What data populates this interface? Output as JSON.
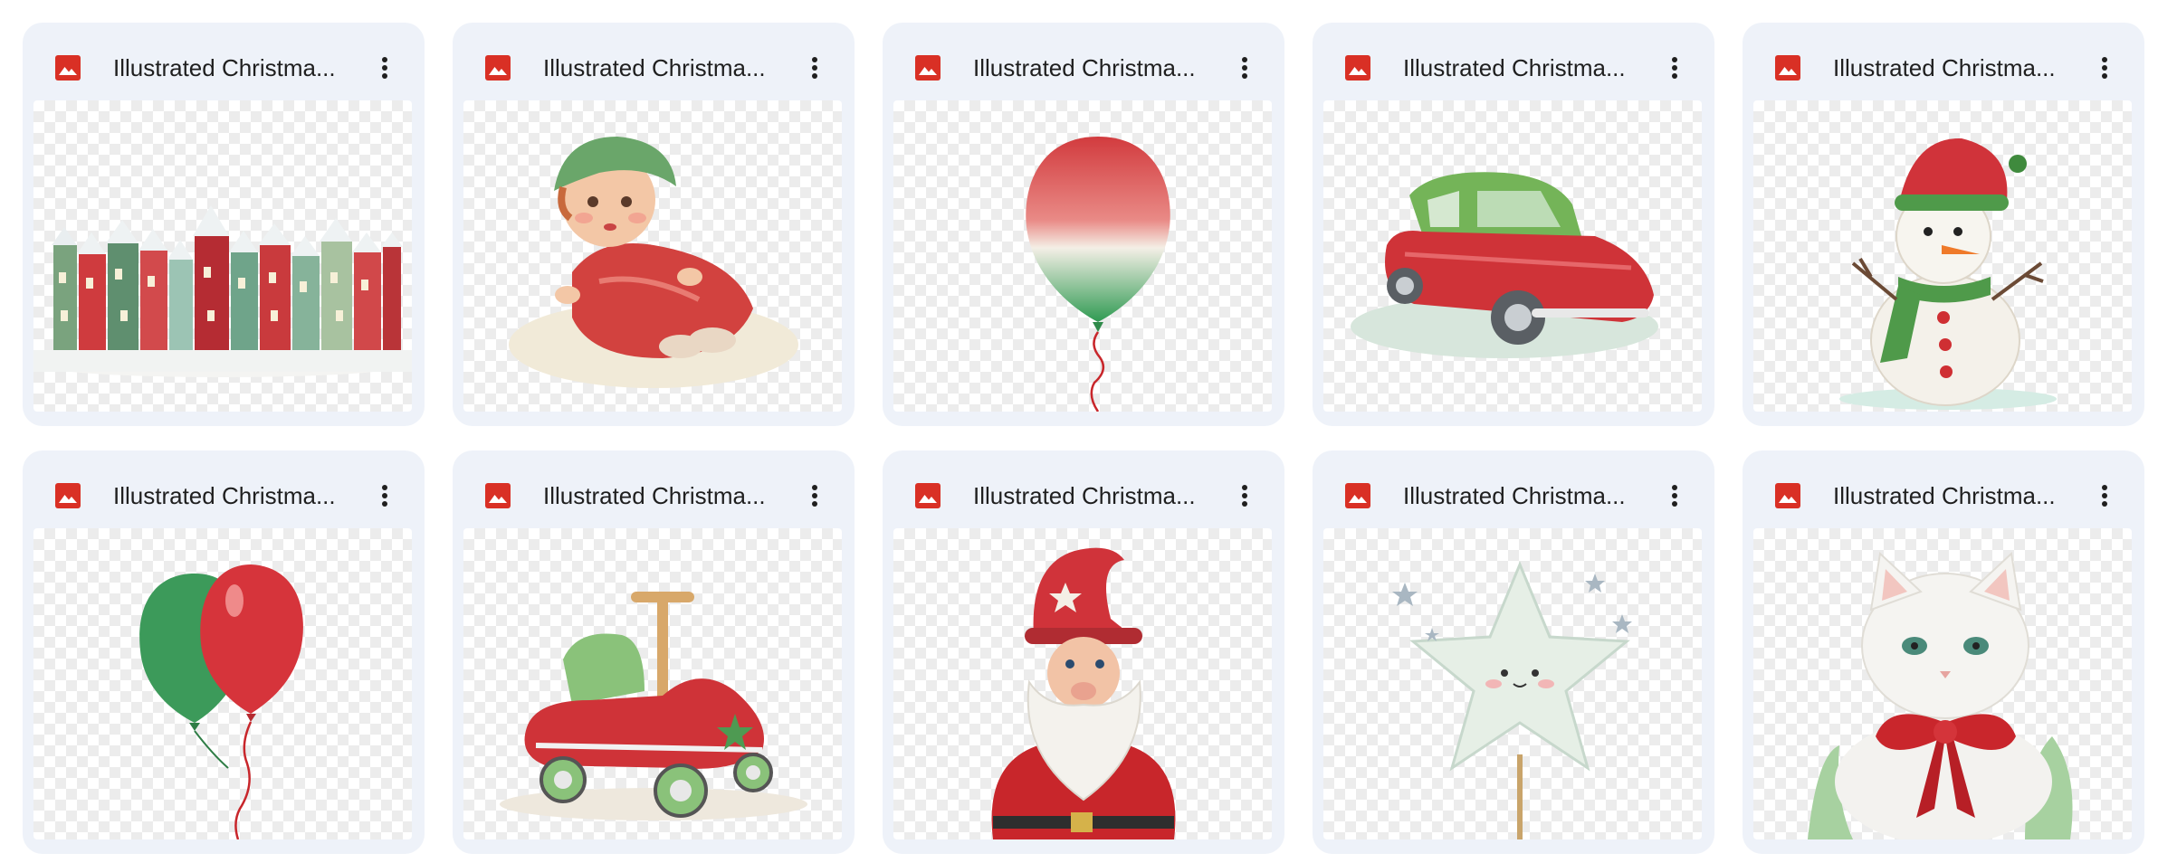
{
  "files": [
    {
      "title": "Illustrated Christma...",
      "icon": "image-file-icon",
      "art": "village-illustration"
    },
    {
      "title": "Illustrated Christma...",
      "icon": "image-file-icon",
      "art": "doll-illustration"
    },
    {
      "title": "Illustrated Christma...",
      "icon": "image-file-icon",
      "art": "balloon-illustration"
    },
    {
      "title": "Illustrated Christma...",
      "icon": "image-file-icon",
      "art": "toy-car-illustration"
    },
    {
      "title": "Illustrated Christma...",
      "icon": "image-file-icon",
      "art": "snowman-illustration"
    },
    {
      "title": "Illustrated Christma...",
      "icon": "image-file-icon",
      "art": "two-balloons-illustration"
    },
    {
      "title": "Illustrated Christma...",
      "icon": "image-file-icon",
      "art": "ride-on-toy-illustration"
    },
    {
      "title": "Illustrated Christma...",
      "icon": "image-file-icon",
      "art": "gnome-illustration"
    },
    {
      "title": "Illustrated Christma...",
      "icon": "image-file-icon",
      "art": "star-illustration"
    },
    {
      "title": "Illustrated Christma...",
      "icon": "image-file-icon",
      "art": "kitten-illustration"
    }
  ],
  "colors": {
    "card_bg": "#eef2f9",
    "file_icon_red": "#d93025",
    "title_text": "#1f1f1f",
    "christmas_red": "#c8262b",
    "christmas_green": "#3f9a4e"
  }
}
